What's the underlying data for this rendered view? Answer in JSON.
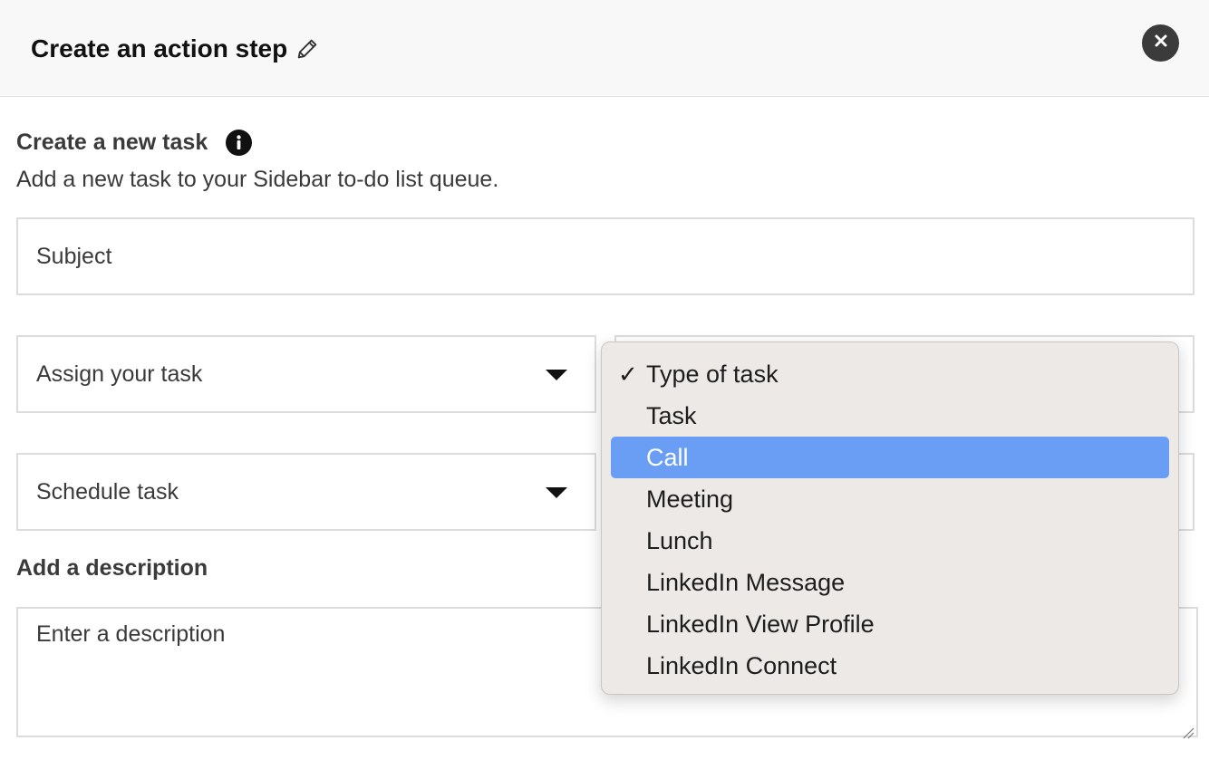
{
  "header": {
    "title": "Create an action step"
  },
  "task_section": {
    "title": "Create a new task",
    "subtitle": "Add a new task to your Sidebar to-do list queue."
  },
  "fields": {
    "subject_placeholder": "Subject",
    "assign_label": "Assign your task",
    "schedule_label": "Schedule task"
  },
  "description": {
    "title": "Add a description",
    "placeholder": "Enter a description"
  },
  "task_type_dropdown": {
    "selected": "Type of task",
    "highlighted": "Call",
    "options": [
      {
        "label": "Type of task"
      },
      {
        "label": "Task"
      },
      {
        "label": "Call"
      },
      {
        "label": "Meeting"
      },
      {
        "label": "Lunch"
      },
      {
        "label": "LinkedIn Message"
      },
      {
        "label": "LinkedIn View Profile"
      },
      {
        "label": "LinkedIn Connect"
      }
    ]
  },
  "colors": {
    "highlight": "#6a9ef5",
    "header_bg": "#f8f8f8",
    "menu_bg": "#ece9e6"
  }
}
